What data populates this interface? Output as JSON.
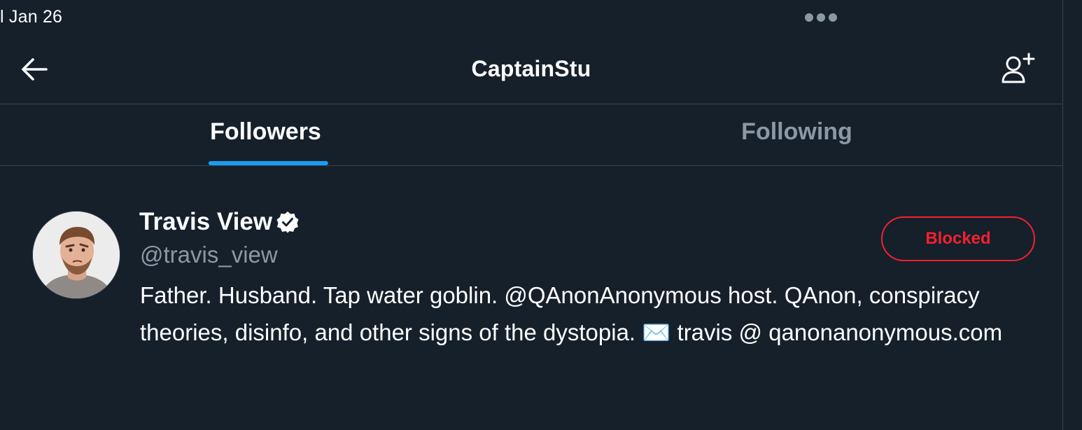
{
  "status_bar": {
    "time": "l Jan 26"
  },
  "header": {
    "title": "CaptainStu",
    "back_icon": "arrow-left-icon",
    "follow_icon": "add-user-icon"
  },
  "tabs": [
    {
      "label": "Followers",
      "active": true
    },
    {
      "label": "Following",
      "active": false
    }
  ],
  "user": {
    "name": "Travis View",
    "handle": "@travis_view",
    "verified": true,
    "bio": "Father. Husband. Tap water goblin. @QAnonAnonymous host. QAnon, conspiracy theories, disinfo, and other signs of the dystopia. ✉️ travis @ qanonanonymous.com",
    "action_label": "Blocked"
  },
  "colors": {
    "background": "#15202b",
    "divider": "#38444d",
    "accent": "#1d9bf0",
    "muted_text": "#8b98a5",
    "blocked_red": "#f4212e"
  }
}
